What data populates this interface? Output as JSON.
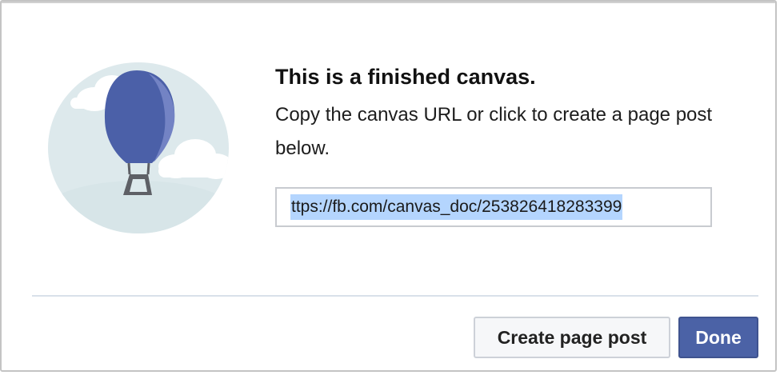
{
  "dialog": {
    "title": "This is a finished canvas.",
    "message": "Copy the canvas URL or click to create a page post below.",
    "url_value": "ttps://fb.com/canvas_doc/253826418283399"
  },
  "illustration": {
    "icon": "hot-air-balloon-icon",
    "colors": {
      "circle_bg": "#dde9ec",
      "cloud": "#ffffff",
      "balloon": "#4b60a8",
      "balloon_shade": "#6f7fc0",
      "basket": "#5e6066"
    }
  },
  "buttons": {
    "secondary_label": "Create page post",
    "primary_label": "Done"
  },
  "colors": {
    "primary_button": "#4b62a6",
    "selection_highlight": "#b4d5fe",
    "divider": "#d9e1ea"
  }
}
